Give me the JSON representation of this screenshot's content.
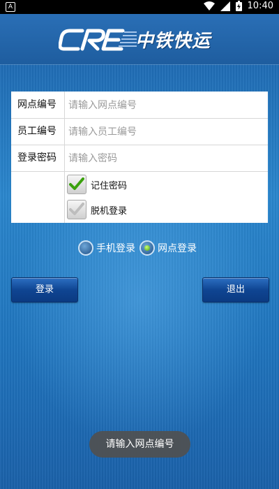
{
  "status_bar": {
    "app_badge": "A",
    "time": "10:40",
    "icons": [
      "wifi-icon",
      "signal-icon",
      "battery-charging-icon"
    ]
  },
  "header": {
    "logo_text": "中铁快运",
    "logo_mark": "CRE"
  },
  "form": {
    "fields": [
      {
        "label": "网点编号",
        "placeholder": "请输入网点编号",
        "value": ""
      },
      {
        "label": "员工编号",
        "placeholder": "请输入员工编号",
        "value": ""
      },
      {
        "label": "登录密码",
        "placeholder": "请输入密码",
        "value": ""
      }
    ],
    "checkboxes": [
      {
        "label": "记住密码",
        "checked": true
      },
      {
        "label": "脱机登录",
        "checked": false
      }
    ]
  },
  "login_mode": {
    "options": [
      {
        "label": "手机登录",
        "selected": false
      },
      {
        "label": "网点登录",
        "selected": true
      }
    ]
  },
  "buttons": {
    "login": "登录",
    "exit": "退出"
  },
  "toast": "请输入网点编号",
  "colors": {
    "accent_green": "#3aa10c",
    "button_blue": "#0f4592",
    "background_blue": "#1f74bd"
  }
}
